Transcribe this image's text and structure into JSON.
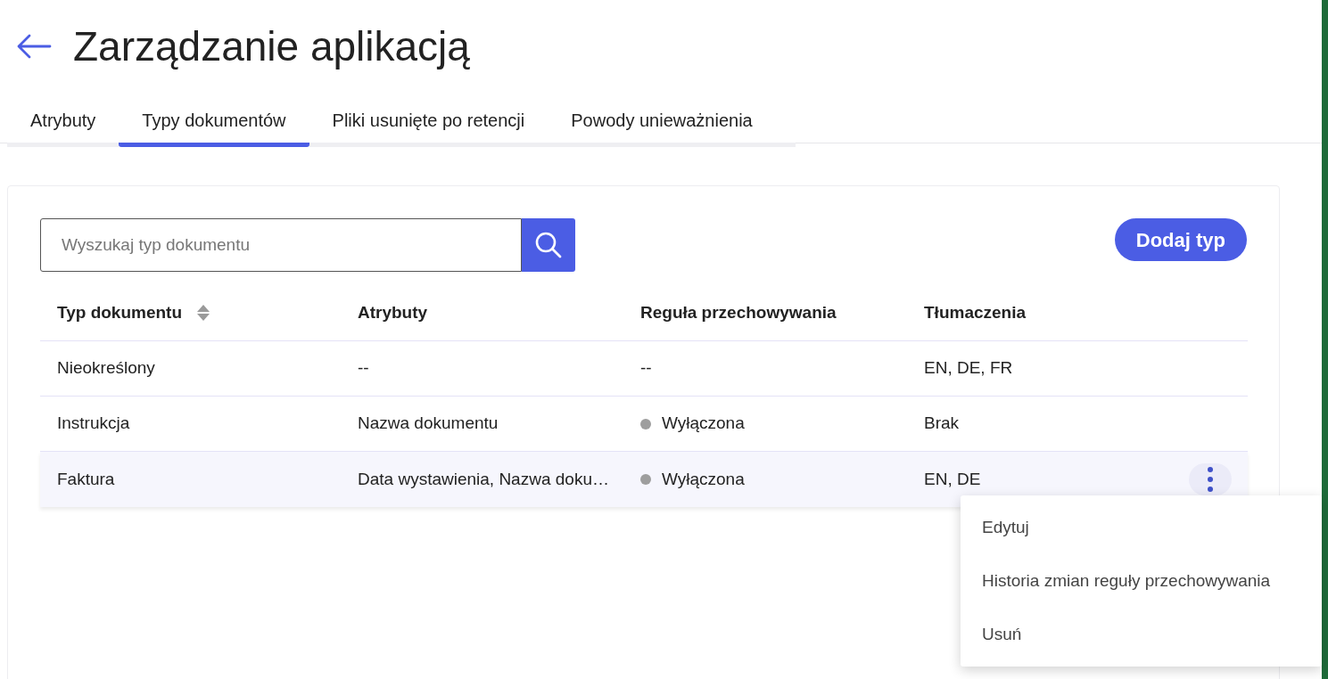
{
  "header": {
    "title": "Zarządzanie aplikacją"
  },
  "tabs": [
    {
      "label": "Atrybuty",
      "selected": false
    },
    {
      "label": "Typy dokumentów",
      "selected": true
    },
    {
      "label": "Pliki usunięte po retencji",
      "selected": false
    },
    {
      "label": "Powody unieważnienia",
      "selected": false
    }
  ],
  "search": {
    "placeholder": "Wyszukaj typ dokumentu"
  },
  "add_button": "Dodaj typ",
  "table": {
    "columns": [
      {
        "label": "Typ dokumentu",
        "sortable": true
      },
      {
        "label": "Atrybuty",
        "sortable": false
      },
      {
        "label": "Reguła przechowywania",
        "sortable": false
      },
      {
        "label": "Tłumaczenia",
        "sortable": false
      }
    ],
    "rows": [
      {
        "type": "Nieokreślony",
        "attributes": "--",
        "rule": "--",
        "translations": "EN, DE, FR",
        "menu_open": false
      },
      {
        "type": "Instrukcja",
        "attributes": "Nazwa dokumentu",
        "rule": "Wyłączona",
        "color": "#9e9e9e",
        "translations": "Brak",
        "menu_open": false
      },
      {
        "type": "Faktura",
        "attributes": "Data wystawienia, Nazwa doku…",
        "rule": "Wyłączona",
        "color": "#9e9e9e",
        "translations": "EN, DE",
        "menu_open": true
      }
    ]
  },
  "row_menu": [
    "Edytuj",
    "Historia zmian reguły przechowywania",
    "Usuń"
  ]
}
